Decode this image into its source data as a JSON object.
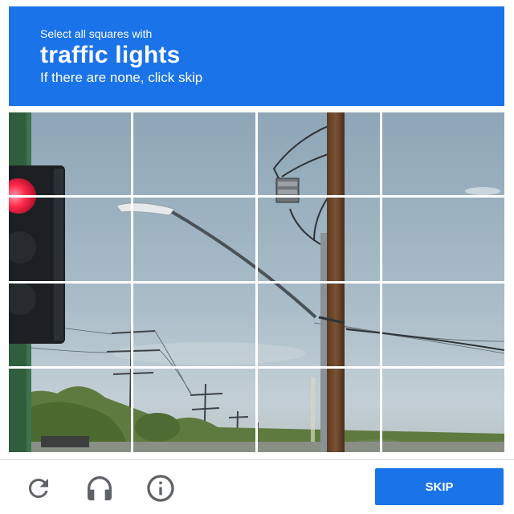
{
  "header": {
    "instruction": "Select all squares with",
    "target": "traffic lights",
    "hint": "If there are none, click skip"
  },
  "grid": {
    "rows": 4,
    "cols": 4
  },
  "footer": {
    "reload_icon": "reload-icon",
    "audio_icon": "headphones-icon",
    "info_icon": "info-icon",
    "skip_label": "SKIP"
  },
  "colors": {
    "accent": "#1a73e8",
    "icon": "#5f6368"
  }
}
